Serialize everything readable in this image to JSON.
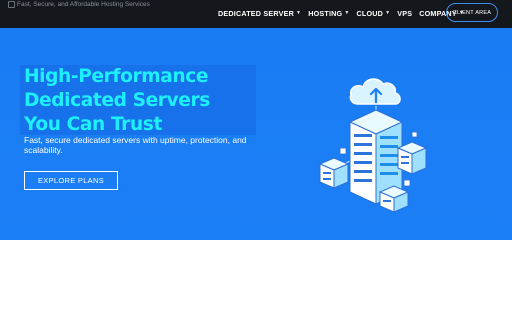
{
  "header": {
    "logo_alt": "Fast, Secure, and Affordable Hosting Services",
    "nav": [
      {
        "label": "DEDICATED SERVER",
        "has_dropdown": true
      },
      {
        "label": "HOSTING",
        "has_dropdown": true
      },
      {
        "label": "CLOUD",
        "has_dropdown": true
      },
      {
        "label": "VPS",
        "has_dropdown": false
      },
      {
        "label": "COMPANY",
        "has_dropdown": true
      }
    ],
    "dropdown_icon": "caret-down-icon",
    "client_button": "CLIENT AREA"
  },
  "hero": {
    "title_lines": [
      "High-Performance",
      "Dedicated Servers",
      "You Can Trust"
    ],
    "subtitle": "Fast, secure dedicated servers with uptime, protection, and scalability.",
    "cta": "EXPLORE PLANS",
    "illustration_icon": "cloud-server-icon"
  },
  "colors": {
    "topbar": "#14171c",
    "hero_background": "#1b7ff7",
    "title_highlight": "#1771ea",
    "title_text": "#1df0fb",
    "client_button_border": "#3f8ff0"
  }
}
